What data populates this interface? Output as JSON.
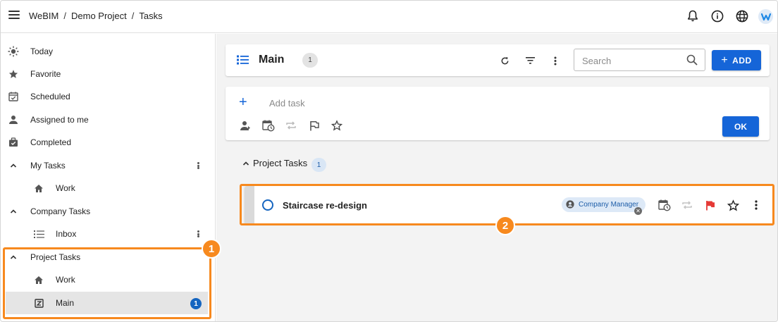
{
  "breadcrumb": [
    "WeBIM",
    "Demo Project",
    "Tasks"
  ],
  "breadcrumb_sep": "/",
  "topbar": {
    "icons": [
      "bell-icon",
      "info-icon",
      "globe-icon",
      "user-avatar"
    ]
  },
  "sidebar": {
    "items": [
      {
        "label": "Today",
        "icon": "sun-icon",
        "indent": 0
      },
      {
        "label": "Favorite",
        "icon": "star-icon",
        "indent": 0
      },
      {
        "label": "Scheduled",
        "icon": "calendar-check-icon",
        "indent": 0
      },
      {
        "label": "Assigned to me",
        "icon": "person-icon",
        "indent": 0
      },
      {
        "label": "Completed",
        "icon": "briefcase-check-icon",
        "indent": 0
      },
      {
        "label": "My Tasks",
        "icon": "chevron-up-icon",
        "indent": 0,
        "menu": true
      },
      {
        "label": "Work",
        "icon": "home-icon",
        "indent": 1
      },
      {
        "label": "Company Tasks",
        "icon": "chevron-up-icon",
        "indent": 0
      },
      {
        "label": "Inbox",
        "icon": "list-icon",
        "indent": 1,
        "menu": true
      },
      {
        "label": "Project Tasks",
        "icon": "chevron-up-icon",
        "indent": 0
      },
      {
        "label": "Work",
        "icon": "home-icon",
        "indent": 1
      },
      {
        "label": "Main",
        "icon": "z-box-icon",
        "indent": 1,
        "active": true,
        "badge": "1"
      }
    ]
  },
  "main": {
    "title": "Main",
    "count": "1",
    "search_placeholder": "Search",
    "add_label": "ADD",
    "add_task_placeholder": "Add task",
    "ok_label": "OK",
    "group": {
      "label": "Project Tasks",
      "count": "1"
    },
    "task": {
      "title": "Staircase re-design",
      "assignee": "Company Manager",
      "flag_color": "#e53935"
    }
  },
  "annotations": {
    "one": "1",
    "two": "2",
    "color": "#f7891e"
  },
  "colors": {
    "accent": "#1565d8",
    "badge": "#1565c0"
  }
}
